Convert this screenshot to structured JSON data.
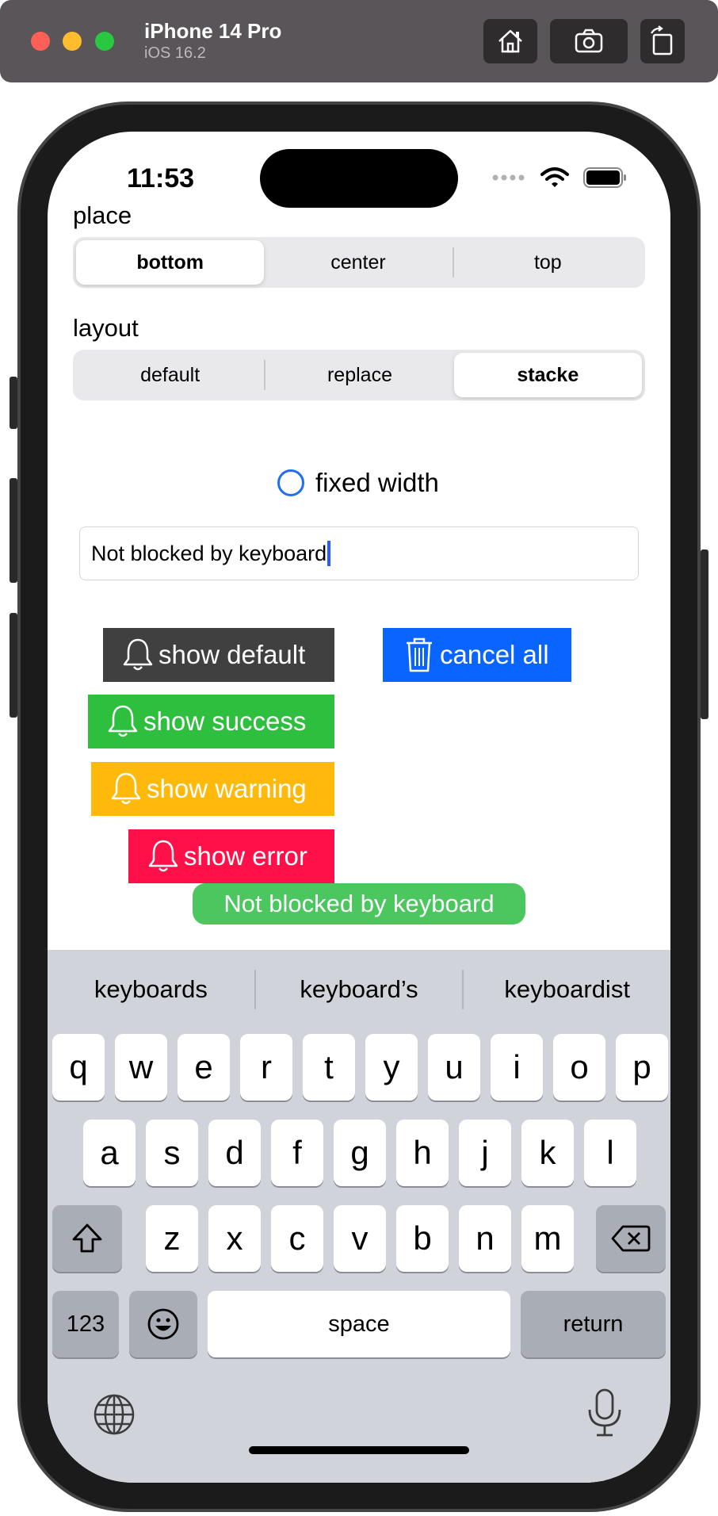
{
  "simulator": {
    "device_name": "iPhone 14 Pro",
    "os_version": "iOS 16.2",
    "toolbar_icons": [
      "home-icon",
      "screenshot-icon",
      "rotate-icon"
    ]
  },
  "status_bar": {
    "time": "11:53",
    "icons": [
      "signal-dots-icon",
      "wifi-icon",
      "battery-icon"
    ]
  },
  "place": {
    "label": "place",
    "options": [
      "bottom",
      "center",
      "top"
    ],
    "selected": "bottom"
  },
  "layout": {
    "label": "layout",
    "options": [
      "default",
      "replace",
      "stacke"
    ],
    "selected": "stacke"
  },
  "fixed_width": {
    "label": "fixed width",
    "checked": false
  },
  "text_field": {
    "value": "Not blocked by keyboard"
  },
  "buttons": {
    "show_default": "show default",
    "cancel_all": "cancel all",
    "show_success": "show success",
    "show_warning": "show warning",
    "show_error": "show error"
  },
  "toast": {
    "message": "Not blocked by keyboard"
  },
  "colors": {
    "default": "#404040",
    "cancel": "#0a64ff",
    "success": "#2fbf3f",
    "warning": "#ffb90a",
    "error": "#ff1048",
    "toast": "#4cc65f"
  },
  "keyboard": {
    "suggestions": [
      "keyboards",
      "keyboard’s",
      "keyboardist"
    ],
    "row1": [
      "q",
      "w",
      "e",
      "r",
      "t",
      "y",
      "u",
      "i",
      "o",
      "p"
    ],
    "row2": [
      "a",
      "s",
      "d",
      "f",
      "g",
      "h",
      "j",
      "k",
      "l"
    ],
    "row3": [
      "z",
      "x",
      "c",
      "v",
      "b",
      "n",
      "m"
    ],
    "numbers_key": "123",
    "space_key": "space",
    "return_key": "return"
  }
}
